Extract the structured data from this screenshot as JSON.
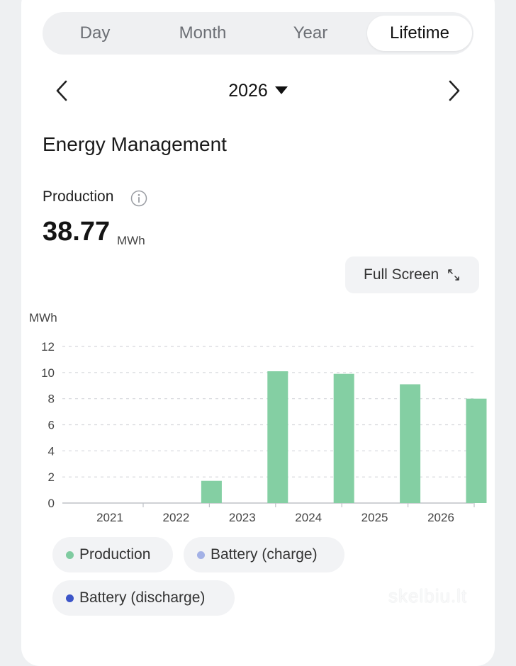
{
  "tabs": [
    {
      "label": "Day",
      "active": false
    },
    {
      "label": "Month",
      "active": false
    },
    {
      "label": "Year",
      "active": false
    },
    {
      "label": "Lifetime",
      "active": true
    }
  ],
  "date_selector": {
    "value": "2026"
  },
  "section_title": "Energy Management",
  "production": {
    "label": "Production",
    "value": "38.77",
    "unit": "MWh"
  },
  "full_screen_label": "Full Screen",
  "legend": [
    {
      "label": "Production",
      "color": "#7fcba0"
    },
    {
      "label": "Battery (charge)",
      "color": "#a3b1e6"
    },
    {
      "label": "Battery (discharge)",
      "color": "#3c55c8"
    }
  ],
  "watermark": "skelbiu.lt",
  "chart_data": {
    "type": "bar",
    "ylabel": "MWh",
    "categories": [
      "2021",
      "2022",
      "2023",
      "2024",
      "2025",
      "2026"
    ],
    "series": [
      {
        "name": "Production",
        "values": [
          0,
          1.7,
          10.1,
          9.9,
          9.1,
          8.0
        ],
        "color": "#84cfa3"
      }
    ],
    "yticks": [
      0,
      2,
      4,
      6,
      8,
      10,
      12
    ],
    "ylim": [
      0,
      12
    ],
    "grid": true
  }
}
